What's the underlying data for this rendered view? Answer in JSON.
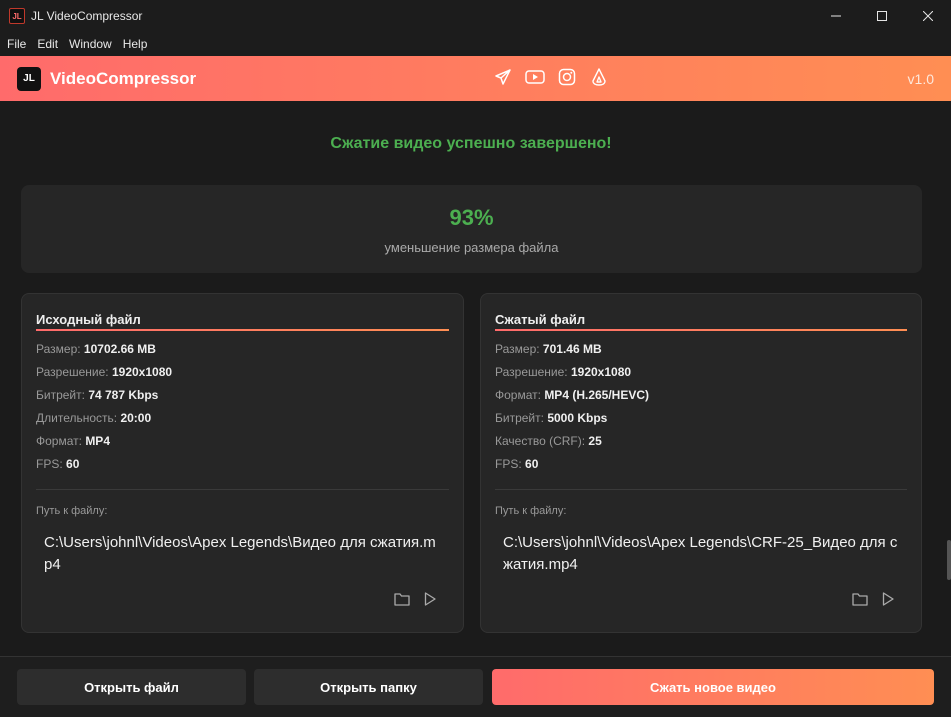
{
  "window": {
    "title": "JL VideoCompressor",
    "icon_text": "JL"
  },
  "menu": [
    "File",
    "Edit",
    "Window",
    "Help"
  ],
  "header": {
    "logo_text": "JL",
    "app_name": "VideoCompressor",
    "version": "v1.0",
    "socials": [
      "telegram-icon",
      "youtube-icon",
      "instagram-icon",
      "boosty-icon"
    ]
  },
  "success_message": "Сжатие видео успешно завершено!",
  "stats": {
    "reduction": "93%",
    "reduction_label": "уменьшение размера файла"
  },
  "source": {
    "title": "Исходный файл",
    "rows": [
      {
        "label": "Размер:",
        "value": "10702.66 MB"
      },
      {
        "label": "Разрешение:",
        "value": "1920x1080"
      },
      {
        "label": "Битрейт:",
        "value": "74 787 Kbps"
      },
      {
        "label": "Длительность:",
        "value": "20:00"
      },
      {
        "label": "Формат:",
        "value": "MP4"
      },
      {
        "label": "FPS:",
        "value": "60"
      }
    ],
    "path_label": "Путь к файлу:",
    "path": "C:\\Users\\johnl\\Videos\\Apex Legends\\Видео для сжатия.mp4"
  },
  "compressed": {
    "title": "Сжатый файл",
    "rows": [
      {
        "label": "Размер:",
        "value": "701.46 MB"
      },
      {
        "label": "Разрешение:",
        "value": "1920x1080"
      },
      {
        "label": "Формат:",
        "value": "MP4 (H.265/HEVC)"
      },
      {
        "label": "Битрейт:",
        "value": "5000 Kbps"
      },
      {
        "label": "Качество (CRF):",
        "value": "25"
      },
      {
        "label": "FPS:",
        "value": "60"
      }
    ],
    "path_label": "Путь к файлу:",
    "path": "C:\\Users\\johnl\\Videos\\Apex Legends\\CRF-25_Видео для сжатия.mp4"
  },
  "footer": {
    "open_file": "Открыть файл",
    "open_folder": "Открыть папку",
    "compress_new": "Сжать новое видео"
  },
  "colors": {
    "accent_start": "#ff6b6b",
    "accent_end": "#ff8e53",
    "success": "#4caf50"
  }
}
